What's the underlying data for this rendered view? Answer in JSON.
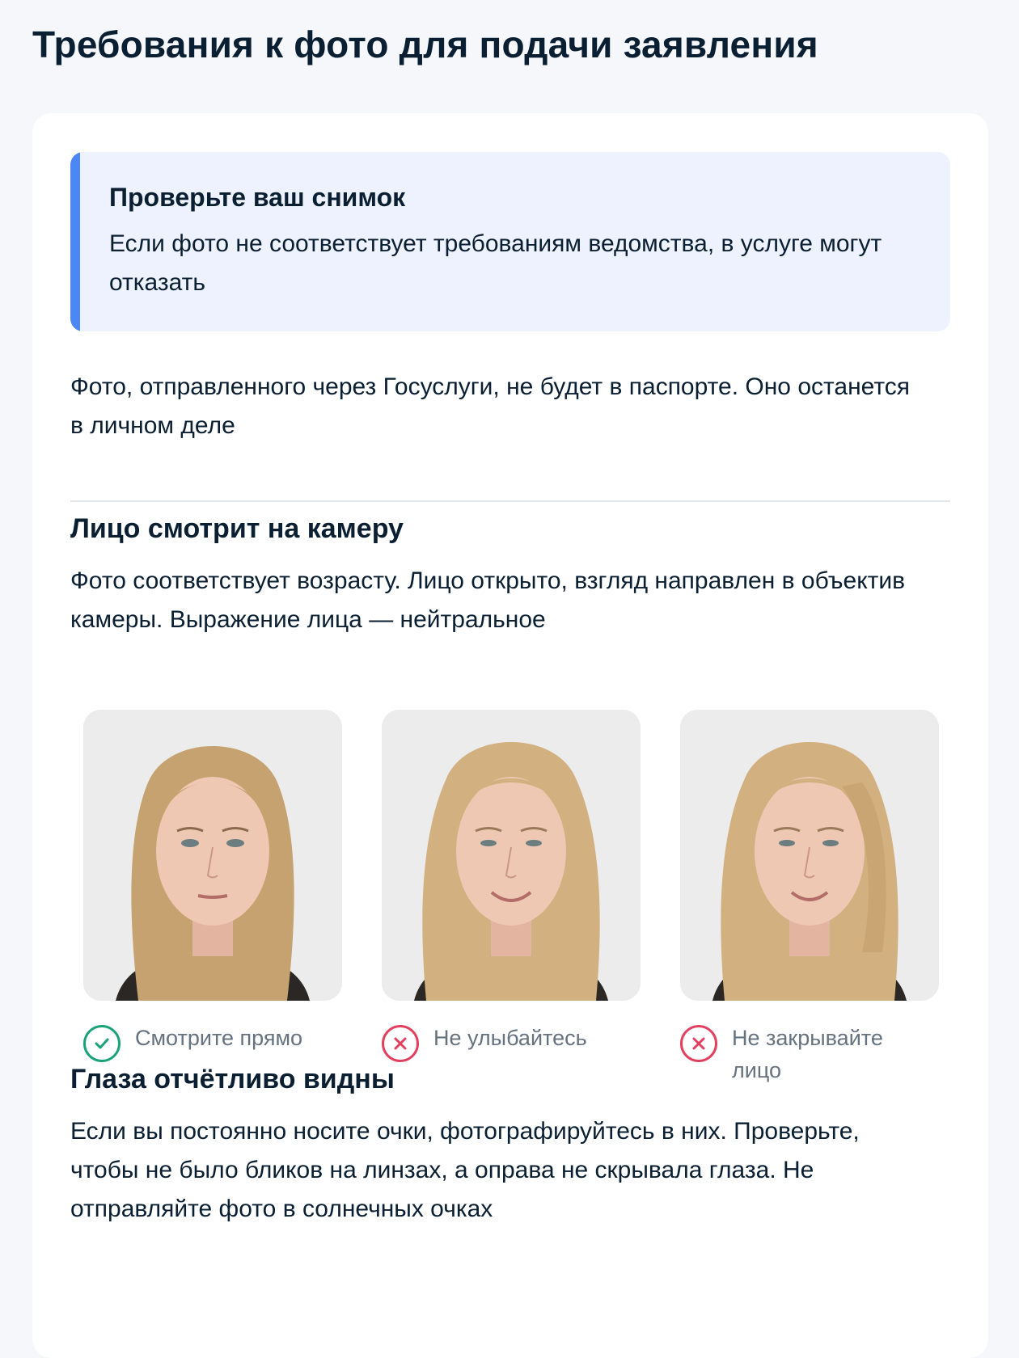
{
  "page": {
    "title": "Требования к фото для подачи заявления"
  },
  "notice": {
    "title": "Проверьте ваш снимок",
    "text": "Если фото не соответствует требованиям ведомства, в услуге могут отказать",
    "accent_color": "#4c87f6",
    "background_color": "#edf2fe"
  },
  "intro_text": "Фото, отправленного через Госуслуги, не будет в паспорте. Оно останется в личном деле",
  "sections": [
    {
      "title": "Лицо смотрит на камеру",
      "text": "Фото соответствует возрасту. Лицо открыто, взгляд направлен в объектив камеры. Выражение лица — нейтральное"
    },
    {
      "title": "Глаза отчётливо видны",
      "text": "Если вы постоянно носите очки, фотографируйтесь в них. Проверьте, чтобы не было бликов на линзах, а оправа не скрывала глаза. Не отправляйте фото в солнечных очках"
    }
  ],
  "examples": [
    {
      "label": "Смотрите прямо",
      "status": "correct",
      "icon": "check-circle-icon",
      "color": "#1aa37a"
    },
    {
      "label": "Не улыбайтесь",
      "status": "incorrect",
      "icon": "cross-circle-icon",
      "color": "#e3405f"
    },
    {
      "label": "Не закрывайте лицо",
      "status": "incorrect",
      "icon": "cross-circle-icon",
      "color": "#e3405f"
    }
  ]
}
